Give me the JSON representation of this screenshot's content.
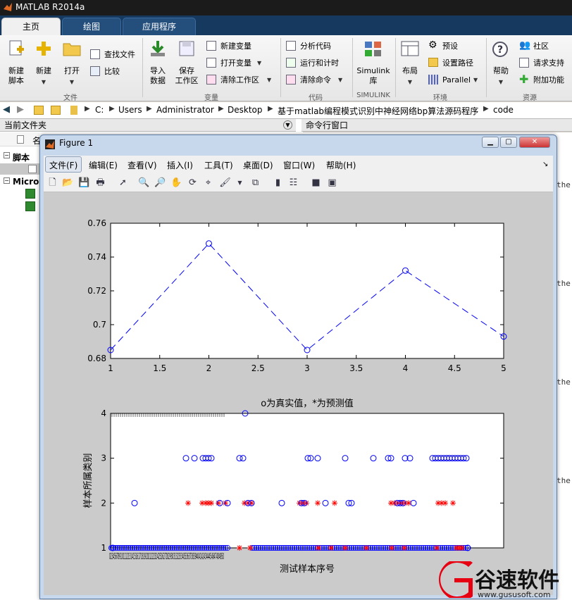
{
  "window": {
    "title": "MATLAB R2014a"
  },
  "tabs": [
    {
      "label": "主页"
    },
    {
      "label": "绘图"
    },
    {
      "label": "应用程序"
    }
  ],
  "ribbon": {
    "new_script": [
      "新建",
      "脚本"
    ],
    "new": "新建",
    "open": "打开",
    "find_files": "查找文件",
    "compare": "比较",
    "import_data": [
      "导入",
      "数据"
    ],
    "save_workspace": [
      "保存",
      "工作区"
    ],
    "new_variable": "新建变量",
    "open_variable": "打开变量",
    "clear_workspace": "清除工作区",
    "analyze_code": "分析代码",
    "run_and_time": "运行和计时",
    "clear_commands": "清除命令",
    "simulink": [
      "Simulink",
      "库"
    ],
    "layout": "布局",
    "preferences": "预设",
    "set_path": "设置路径",
    "parallel": "Parallel",
    "help": "帮助",
    "community": "社区",
    "request_support": "请求支持",
    "add_ons": "附加功能",
    "groups": {
      "file": "文件",
      "variable": "变量",
      "code": "代码",
      "simulink": "SIMULINK",
      "environment": "环境",
      "resources": "资源"
    }
  },
  "address": {
    "crumbs": [
      "C:",
      "Users",
      "Administrator",
      "Desktop",
      "基于matlab编程模式识别中神经网络bp算法源码程序",
      "code"
    ]
  },
  "panels": {
    "current_folder": "当前文件夹",
    "command_window": "命令行窗口",
    "name_col": "名",
    "section_script": "脚本",
    "section_micro": "Micro",
    "cmd_text": "the"
  },
  "figure": {
    "title": "Figure 1",
    "menus": [
      "文件(F)",
      "编辑(E)",
      "查看(V)",
      "插入(I)",
      "工具(T)",
      "桌面(D)",
      "窗口(W)",
      "帮助(H)"
    ]
  },
  "chart_data": [
    {
      "type": "line",
      "x": [
        1,
        2,
        3,
        4,
        5
      ],
      "values": [
        0.685,
        0.748,
        0.685,
        0.732,
        0.693
      ],
      "xlim": [
        1,
        5
      ],
      "ylim": [
        0.68,
        0.76
      ],
      "xticks": [
        "1",
        "1.5",
        "2",
        "2.5",
        "3",
        "3.5",
        "4",
        "4.5",
        "5"
      ],
      "yticks": [
        "0.68",
        "0.7",
        "0.72",
        "0.74",
        "0.76"
      ],
      "line_style": "dashed",
      "marker": "circle",
      "color": "#0000ff",
      "title": "",
      "xlabel": "",
      "ylabel": ""
    },
    {
      "type": "scatter",
      "title": "o为真实值，*为预测值",
      "xlabel": "测试样本序号",
      "ylabel": "样本所属类别",
      "ylim": [
        1,
        4
      ],
      "yticks": [
        "1",
        "2",
        "3",
        "4"
      ],
      "xtick_labels": "0234567891011121314151617181920212223242526272829303132333435363738394041424344454647484950",
      "series": [
        {
          "marker": "circle",
          "color": "#0000ff",
          "points": [
            [
              160,
              1
            ],
            [
              191,
              2
            ],
            [
              264,
              3
            ],
            [
              276,
              3
            ],
            [
              288,
              3
            ],
            [
              292,
              3
            ],
            [
              296,
              3
            ],
            [
              300,
              3
            ],
            [
              312,
              2
            ],
            [
              323,
              2
            ],
            [
              340,
              3
            ],
            [
              345,
              3
            ],
            [
              348,
              4
            ],
            [
              352,
              2
            ],
            [
              357,
              2
            ],
            [
              400,
              2
            ],
            [
              428,
              2
            ],
            [
              432,
              2
            ],
            [
              437,
              3
            ],
            [
              441,
              3
            ],
            [
              451,
              3
            ],
            [
              462,
              2
            ],
            [
              490,
              3
            ],
            [
              495,
              2
            ],
            [
              499,
              2
            ],
            [
              530,
              3
            ],
            [
              551,
              3
            ],
            [
              555,
              3
            ],
            [
              564,
              2
            ],
            [
              568,
              2
            ],
            [
              572,
              2
            ],
            [
              575,
              3
            ],
            [
              582,
              3
            ],
            [
              587,
              2
            ],
            [
              614,
              3
            ],
            [
              618,
              3
            ],
            [
              622,
              3
            ],
            [
              626,
              3
            ],
            [
              630,
              3
            ],
            [
              634,
              3
            ],
            [
              638,
              3
            ],
            [
              642,
              3
            ],
            [
              646,
              3
            ],
            [
              650,
              3
            ],
            [
              654,
              3
            ],
            [
              658,
              3
            ],
            [
              662,
              3
            ],
            [
              664,
              1
            ]
          ]
        },
        {
          "marker": "star",
          "color": "#ff0000",
          "points": [
            [
              267,
              2
            ],
            [
              287,
              2
            ],
            [
              292,
              2
            ],
            [
              296,
              2
            ],
            [
              300,
              2
            ],
            [
              310,
              2
            ],
            [
              320,
              2
            ],
            [
              347,
              2
            ],
            [
              352,
              2
            ],
            [
              357,
              2
            ],
            [
              425,
              2
            ],
            [
              430,
              2
            ],
            [
              435,
              2
            ],
            [
              451,
              2
            ],
            [
              475,
              2
            ],
            [
              555,
              2
            ],
            [
              560,
              2
            ],
            [
              565,
              2
            ],
            [
              570,
              2
            ],
            [
              575,
              2
            ],
            [
              580,
              2
            ],
            [
              622,
              2
            ],
            [
              627,
              2
            ],
            [
              632,
              2
            ],
            [
              643,
              2
            ],
            [
              340,
              1
            ],
            [
              355,
              1
            ],
            [
              452,
              1
            ],
            [
              470,
              1
            ],
            [
              490,
              1
            ],
            [
              520,
              1
            ],
            [
              556,
              1
            ],
            [
              574,
              1
            ],
            [
              620,
              1
            ],
            [
              648,
              1
            ],
            [
              652,
              1
            ],
            [
              656,
              1
            ]
          ]
        }
      ],
      "dense_low_ranges": [
        [
          158,
          325
        ],
        [
          358,
          664
        ]
      ]
    }
  ],
  "watermark": {
    "brand": "谷速软件",
    "url": "www.gususoft.com"
  }
}
